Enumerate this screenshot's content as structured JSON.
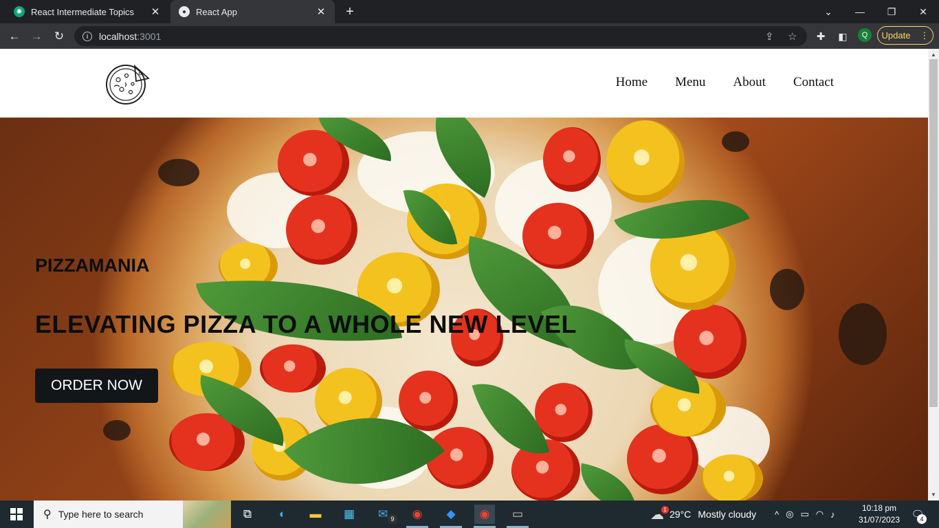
{
  "browser": {
    "tabs": [
      {
        "title": "React Intermediate Topics",
        "favicon": "chatgpt-icon",
        "active": false
      },
      {
        "title": "React App",
        "favicon": "globe-icon",
        "active": true
      }
    ],
    "url_host": "localhost",
    "url_port": ":3001",
    "profile_initial": "Q",
    "update_label": "Update"
  },
  "page": {
    "nav": {
      "items": [
        "Home",
        "Menu",
        "About",
        "Contact"
      ]
    },
    "hero": {
      "title": "PIZZAMANIA",
      "subtitle": "ELEVATING PIZZA TO A WHOLE NEW LEVEL",
      "cta": "ORDER NOW"
    }
  },
  "taskbar": {
    "search_placeholder": "Type here to search",
    "mail_badge": "9",
    "weather_temp": "29°C",
    "weather_desc": "Mostly cloudy",
    "weather_alert": "1",
    "time": "10:18 pm",
    "date": "31/07/2023",
    "notification_count": "4"
  }
}
